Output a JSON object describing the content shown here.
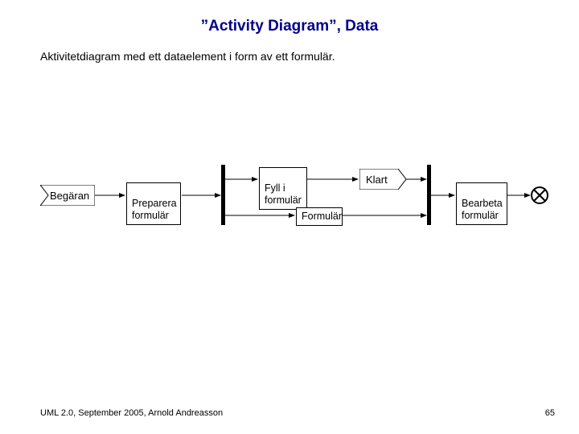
{
  "title": "”Activity Diagram”, Data",
  "subtitle": "Aktivitetdiagram med ett dataelement i form av ett formulär.",
  "nodes": {
    "begaran": "Begäran",
    "preparera": "Preparera\nformulär",
    "fyll": "Fyll i\nformulär",
    "formular": "Formulär",
    "klart": "Klart",
    "bearbeta": "Bearbeta\nformulär"
  },
  "footer": {
    "left": "UML 2.0, September 2005, Arnold Andreasson",
    "right": "65"
  }
}
